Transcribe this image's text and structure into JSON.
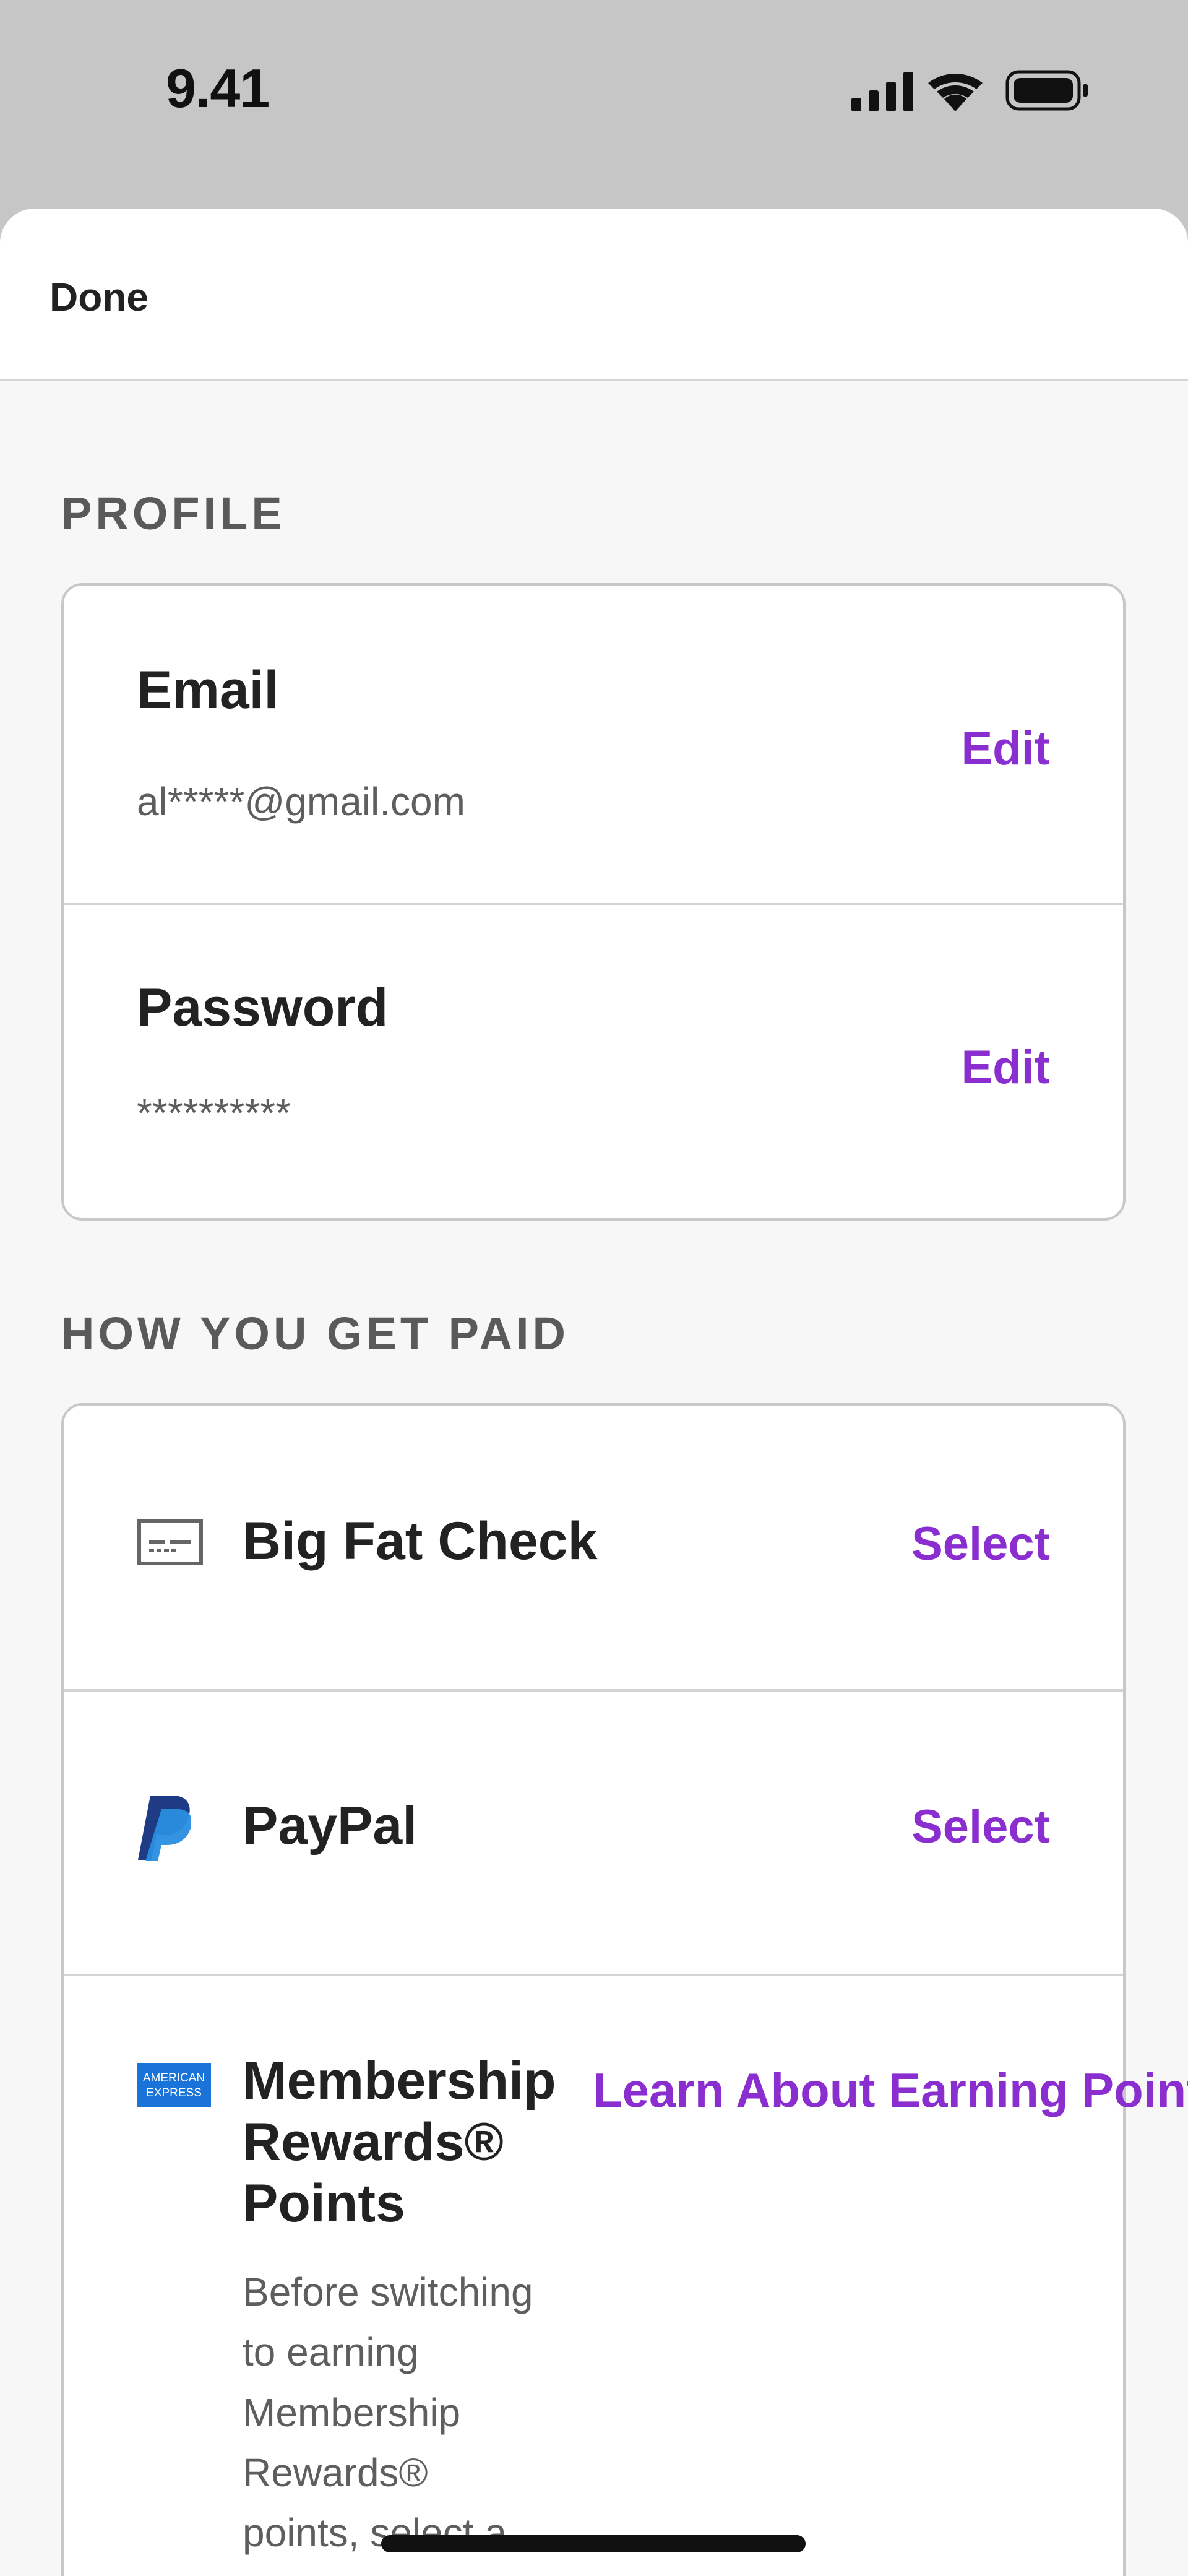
{
  "status_bar": {
    "time": "9.41"
  },
  "sheet": {
    "done_label": "Done"
  },
  "profile": {
    "title": "PROFILE",
    "email": {
      "label": "Email",
      "value": "al*****@gmail.com",
      "action": "Edit"
    },
    "password": {
      "label": "Password",
      "value": "**********",
      "action": "Edit"
    }
  },
  "payment": {
    "title": "HOW YOU GET PAID",
    "options": [
      {
        "label": "Big Fat Check",
        "action": "Select",
        "icon": "check-icon"
      },
      {
        "label": "PayPal",
        "action": "Select",
        "icon": "paypal-icon"
      },
      {
        "label_lines": [
          "Membership",
          "Rewards®",
          "Points"
        ],
        "description_lines": [
          "Before switching",
          "to earning",
          "Membership",
          "Rewards®",
          "points, select a"
        ],
        "action": "Learn About Earning Points",
        "icon": "american-express-icon",
        "amex_logo_text": [
          "AMERICAN",
          "EXPRESS"
        ]
      }
    ]
  },
  "colors": {
    "accent": "#8a2ed0",
    "status_bg": "#c6c6c6",
    "sheet_bg": "#f7f7f7"
  }
}
